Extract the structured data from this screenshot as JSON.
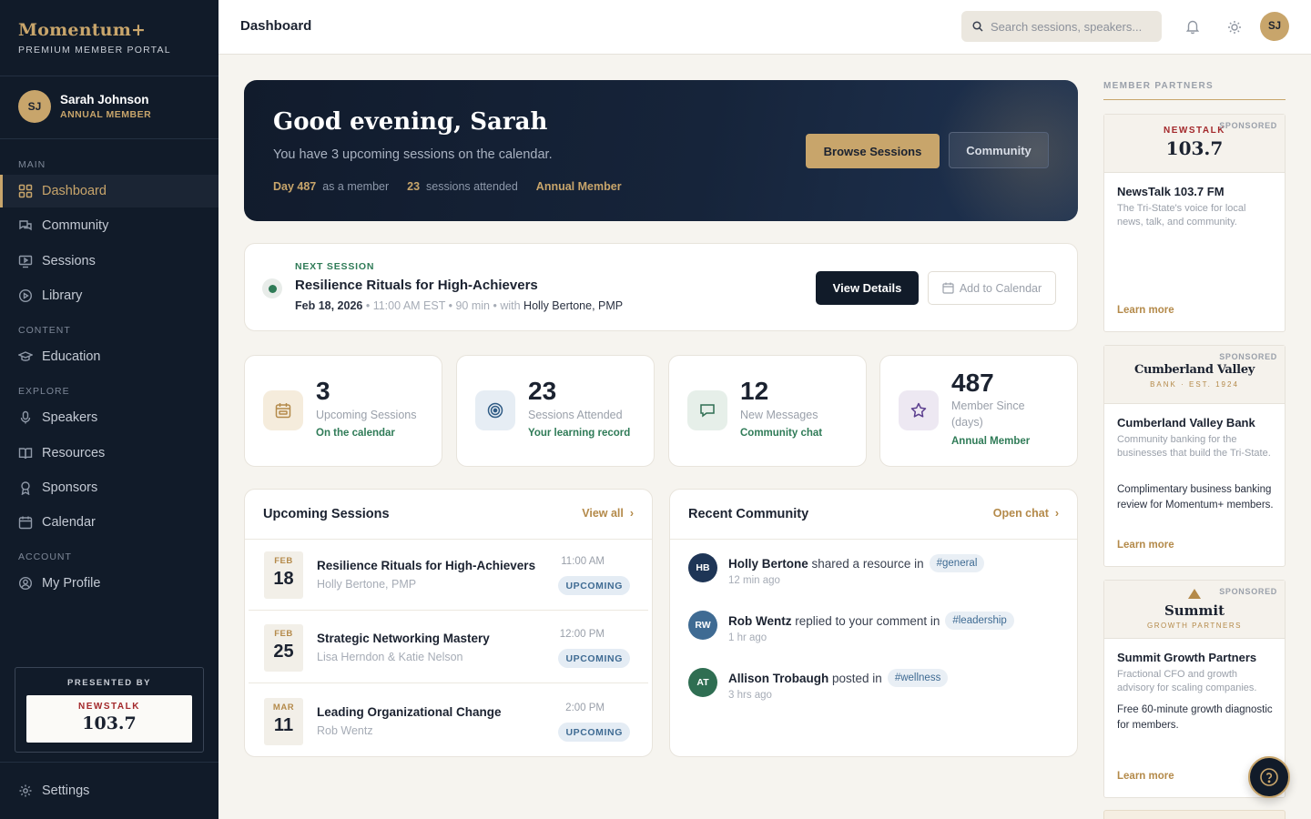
{
  "brand": {
    "name": "Momentum+",
    "subtitle": "PREMIUM MEMBER PORTAL"
  },
  "user": {
    "initials": "SJ",
    "name": "Sarah Johnson",
    "tier": "ANNUAL MEMBER"
  },
  "nav": {
    "sections": {
      "main": "MAIN",
      "content": "CONTENT",
      "explore": "EXPLORE",
      "account": "ACCOUNT"
    },
    "items": [
      {
        "label": "Dashboard",
        "icon": "dashboard-grid-icon",
        "active": true
      },
      {
        "label": "Community",
        "icon": "chat-icon"
      },
      {
        "label": "Sessions",
        "icon": "screen-play-icon"
      },
      {
        "label": "Library",
        "icon": "play-circle-icon"
      },
      {
        "label": "Education",
        "icon": "graduation-cap-icon"
      },
      {
        "label": "Speakers",
        "icon": "microphone-icon"
      },
      {
        "label": "Resources",
        "icon": "book-open-icon"
      },
      {
        "label": "Sponsors",
        "icon": "award-icon"
      },
      {
        "label": "Calendar",
        "icon": "calendar-icon"
      },
      {
        "label": "My Profile",
        "icon": "user-circle-icon"
      }
    ],
    "settings": "Settings"
  },
  "presented_by": {
    "label": "PRESENTED BY",
    "logo_top": "NEWSTALK",
    "logo_num": "103.7"
  },
  "header": {
    "title": "Dashboard",
    "search_placeholder": "Search sessions, speakers...",
    "avatar": "SJ"
  },
  "hero": {
    "title": "Good evening, Sarah",
    "subtitle": "You have 3 upcoming sessions on the calendar.",
    "day_value": "Day 487",
    "day_text": "as a member",
    "sessions_value": "23",
    "sessions_text": "sessions attended",
    "tier": "Annual Member",
    "browse_button": "Browse Sessions",
    "community_button": "Community"
  },
  "next_session": {
    "label": "NEXT SESSION",
    "title": "Resilience Rituals for High-Achievers",
    "date": "Feb 18, 2026",
    "time": "11:00 AM EST",
    "duration": "90 min",
    "with_text": "with",
    "speaker": "Holly Bertone, PMP",
    "details_button": "View Details",
    "calendar_button": "Add to Calendar"
  },
  "stats": [
    {
      "value": "3",
      "label": "Upcoming Sessions",
      "foot": "On the calendar",
      "icon": "calendar-icon"
    },
    {
      "value": "23",
      "label": "Sessions Attended",
      "foot": "Your learning record",
      "icon": "target-icon"
    },
    {
      "value": "12",
      "label": "New Messages",
      "foot": "Community chat",
      "icon": "message-icon"
    },
    {
      "value": "487",
      "label": "Member Since (days)",
      "foot": "Annual Member",
      "icon": "star-icon"
    }
  ],
  "upcoming": {
    "title": "Upcoming Sessions",
    "link": "View all",
    "sessions": [
      {
        "month": "FEB",
        "day": "18",
        "title": "Resilience Rituals for High-Achievers",
        "speaker": "Holly Bertone, PMP",
        "time": "11:00 AM",
        "status": "UPCOMING"
      },
      {
        "month": "FEB",
        "day": "25",
        "title": "Strategic Networking Mastery",
        "speaker": "Lisa Herndon & Katie Nelson",
        "time": "12:00 PM",
        "status": "UPCOMING"
      },
      {
        "month": "MAR",
        "day": "11",
        "title": "Leading Organizational Change",
        "speaker": "Rob Wentz",
        "time": "2:00 PM",
        "status": "UPCOMING"
      }
    ]
  },
  "community": {
    "title": "Recent Community",
    "link": "Open chat",
    "feed": [
      {
        "initials": "HB",
        "name": "Holly Bertone",
        "action": "shared a resource in",
        "tag": "general",
        "time": "12 min ago",
        "color": "#1e3556"
      },
      {
        "initials": "RW",
        "name": "Rob Wentz",
        "action": "replied to your comment in",
        "tag": "leadership",
        "time": "1 hr ago",
        "color": "#3f6b93"
      },
      {
        "initials": "AT",
        "name": "Allison Trobaugh",
        "action": "posted in",
        "tag": "wellness",
        "time": "3 hrs ago",
        "color": "#2f6e52"
      }
    ]
  },
  "partners": {
    "heading": "MEMBER PARTNERS",
    "sponsored": "SPONSORED",
    "learn_more": "Learn more",
    "ads": [
      {
        "logo_top": "NEWSTALK",
        "logo_num": "103.7",
        "name": "NewsTalk 103.7 FM",
        "desc": "The Tri-State's voice for local news, talk, and community."
      },
      {
        "logo_name": "Cumberland Valley",
        "logo_sub": "BANK · EST. 1924",
        "name": "Cumberland Valley Bank",
        "desc": "Community banking for the businesses that build the Tri-State.",
        "offer": "Complimentary business banking review for Momentum+ members."
      },
      {
        "logo_name": "Summit",
        "logo_sub": "GROWTH PARTNERS",
        "name": "Summit Growth Partners",
        "desc": "Fractional CFO and growth advisory for scaling companies.",
        "offer": "Free 60-minute growth diagnostic for members."
      }
    ]
  },
  "colors": {
    "navy": "#111b29",
    "gold": "#c8a56b",
    "green": "#2f7b57",
    "badge_blue": "#3f6b93"
  }
}
